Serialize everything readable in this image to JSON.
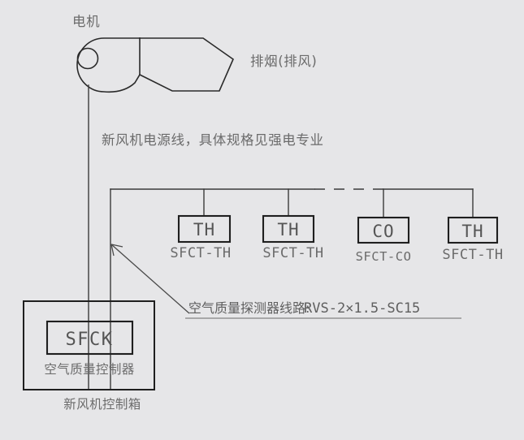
{
  "diagram": {
    "title_motor": "电机",
    "title_exhaust": "排烟(排风)",
    "power_line_note": "新风机电源线，具体规格见强电专业",
    "cable_note_cn": "空气质量探测器线路:",
    "cable_note_spec": "RVS-2×1.5-SC15",
    "controller": {
      "tag": "SFCK",
      "inner_label": "空气质量控制器",
      "outer_label": "新风机控制箱"
    },
    "sensors": [
      {
        "tag": "TH",
        "label": "SFCT-TH"
      },
      {
        "tag": "TH",
        "label": "SFCT-TH"
      },
      {
        "tag": "CO",
        "label": "SFCT-CO"
      },
      {
        "tag": "TH",
        "label": "SFCT-TH"
      }
    ],
    "colors": {
      "background": "#e6e6e8",
      "line": "#2a2a2a",
      "text": "#6b6b6b",
      "box_line": "#1f1f1f"
    }
  }
}
